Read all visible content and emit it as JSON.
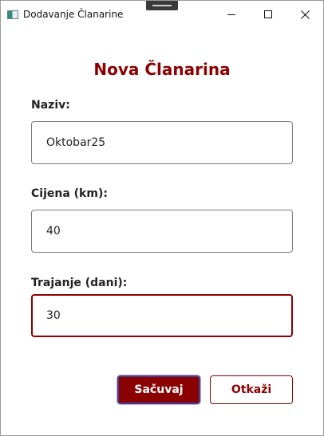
{
  "window": {
    "title": "Dodavanje Članarine"
  },
  "icons": {
    "app": "app-window-icon",
    "minimize": "minimize-icon",
    "maximize": "maximize-icon",
    "close": "close-icon"
  },
  "form": {
    "heading": "Nova Članarina",
    "fields": [
      {
        "label": "Naziv:",
        "value": "Oktobar25",
        "focused": false
      },
      {
        "label": "Cijena (km):",
        "value": "40",
        "focused": false
      },
      {
        "label": "Trajanje (dani):",
        "value": "30",
        "focused": true
      }
    ],
    "save_label": "Sačuvaj",
    "cancel_label": "Otkaži"
  },
  "colors": {
    "accent": "#8b0000",
    "focus_ring": "#4b3c8a"
  }
}
